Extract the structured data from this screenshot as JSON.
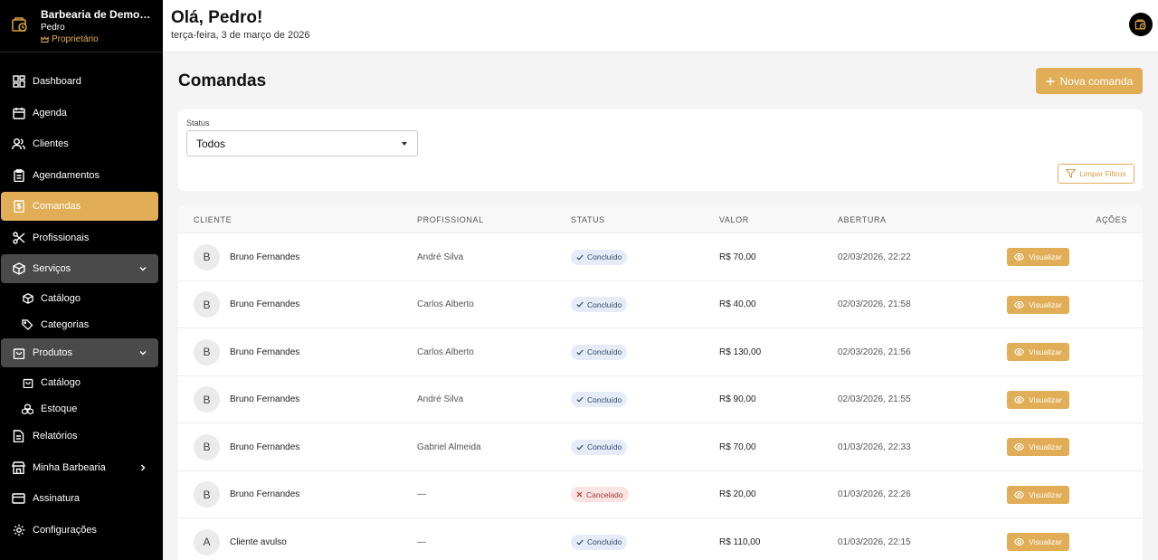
{
  "brand": {
    "name": "Barbearia de Demonstração",
    "user": "Pedro",
    "role": "Proprietário"
  },
  "nav": {
    "dashboard": "Dashboard",
    "agenda": "Agenda",
    "clientes": "Clientes",
    "agendamentos": "Agendamentos",
    "comandas": "Comandas",
    "profissionais": "Profissionais",
    "servicos": "Serviços",
    "servicos_catalogo": "Catálogo",
    "servicos_categorias": "Categorias",
    "produtos": "Produtos",
    "produtos_catalogo": "Catálogo",
    "produtos_estoque": "Estoque",
    "relatorios": "Relatórios",
    "minha_barbearia": "Minha Barbearia",
    "assinatura": "Assinatura",
    "configuracoes": "Configurações"
  },
  "header": {
    "greeting": "Olá, Pedro!",
    "date": "terça-feira, 3 de março de 2026"
  },
  "page": {
    "title": "Comandas",
    "new_button": "Nova comanda"
  },
  "filters": {
    "status_label": "Status",
    "status_value": "Todos",
    "clear_button": "Limpar Filtros"
  },
  "table": {
    "columns": {
      "cliente": "CLIENTE",
      "profissional": "PROFISSIONAL",
      "status": "STATUS",
      "valor": "VALOR",
      "abertura": "ABERTURA",
      "acoes": "AÇÕES"
    },
    "view_label": "Visualizar",
    "rows": [
      {
        "initial": "B",
        "cliente": "Bruno Fernandes",
        "profissional": "André Silva",
        "status": "Concluído",
        "status_type": "ok",
        "valor": "R$ 70,00",
        "abertura": "02/03/2026, 22:22"
      },
      {
        "initial": "B",
        "cliente": "Bruno Fernandes",
        "profissional": "Carlos Alberto",
        "status": "Concluído",
        "status_type": "ok",
        "valor": "R$ 40,00",
        "abertura": "02/03/2026, 21:58"
      },
      {
        "initial": "B",
        "cliente": "Bruno Fernandes",
        "profissional": "Carlos Alberto",
        "status": "Concluído",
        "status_type": "ok",
        "valor": "R$ 130,00",
        "abertura": "02/03/2026, 21:56"
      },
      {
        "initial": "B",
        "cliente": "Bruno Fernandes",
        "profissional": "André Silva",
        "status": "Concluído",
        "status_type": "ok",
        "valor": "R$ 90,00",
        "abertura": "02/03/2026, 21:55"
      },
      {
        "initial": "B",
        "cliente": "Bruno Fernandes",
        "profissional": "Gabriel Almeida",
        "status": "Concluído",
        "status_type": "ok",
        "valor": "R$ 70,00",
        "abertura": "01/03/2026, 22:33"
      },
      {
        "initial": "B",
        "cliente": "Bruno Fernandes",
        "profissional": "—",
        "status": "Cancelado",
        "status_type": "cancel",
        "valor": "R$ 20,00",
        "abertura": "01/03/2026, 22:26"
      },
      {
        "initial": "A",
        "cliente": "Cliente avulso",
        "profissional": "—",
        "status": "Concluído",
        "status_type": "ok",
        "valor": "R$ 110,00",
        "abertura": "01/03/2026, 22:15"
      }
    ]
  },
  "colors": {
    "accent": "#e1ad57",
    "sidebar_bg": "#000000",
    "group_bg": "#4a4a4a",
    "ok_badge": "#e6ecf7",
    "cancel_badge": "#fae3e3"
  },
  "icons": {
    "brand": "barbershop-logo-icon",
    "dashboard": "grid-icon",
    "agenda": "calendar-icon",
    "clientes": "users-icon",
    "agendamentos": "clipboard-icon",
    "comandas": "receipt-icon",
    "profissionais": "scissors-icon",
    "servicos": "box-icon",
    "produtos": "bag-icon",
    "relatorios": "document-icon",
    "minha_barbearia": "store-icon",
    "assinatura": "credit-card-icon",
    "configuracoes": "gear-icon",
    "view": "eye-icon",
    "filter": "filter-icon",
    "add": "plus-icon"
  }
}
